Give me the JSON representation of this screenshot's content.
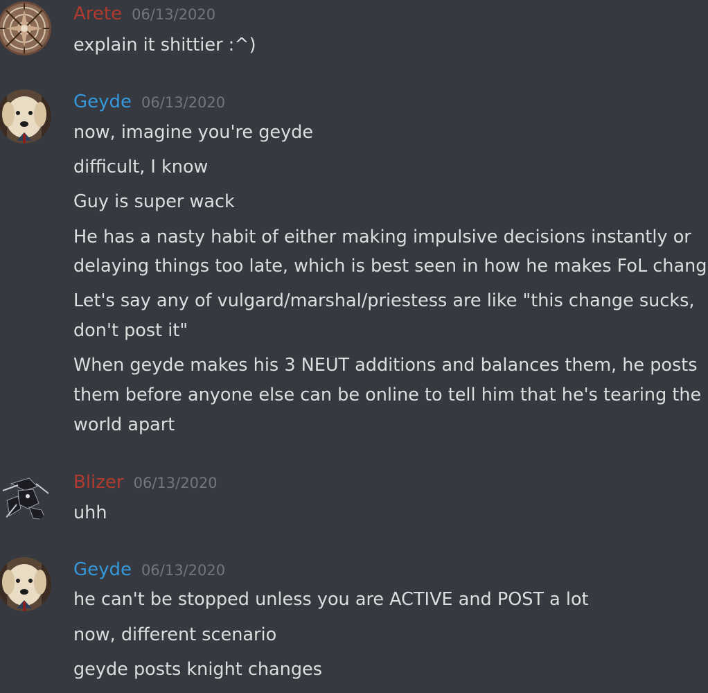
{
  "colors": {
    "background": "#36393f",
    "text": "#dcddde",
    "timestamp": "#72767d",
    "arete_name": "#b03a2e",
    "geyde_name": "#3498db",
    "blizer_name": "#b03a2e"
  },
  "groups": [
    {
      "username": "Arete",
      "timestamp": "06/13/2020",
      "avatar": "kaleidoscope-avatar",
      "messages": [
        "explain it shittier :^)"
      ]
    },
    {
      "username": "Geyde",
      "timestamp": "06/13/2020",
      "avatar": "dog-avatar",
      "messages": [
        "now, imagine you're geyde",
        "difficult, I know",
        "Guy is super wack",
        "He has a nasty habit of either making impulsive decisions instantly or",
        "delaying things too late, which is best seen in how he makes FoL changes",
        "Let's say any of vulgard/marshal/priestess are like \"this change sucks,",
        "don't post it\"",
        "When geyde makes his 3 NEUT additions and balances them, he posts",
        "them before anyone else can be online to tell him that he's tearing the",
        "world apart"
      ]
    },
    {
      "username": "Blizer",
      "timestamp": "06/13/2020",
      "avatar": "anime-figure-avatar",
      "messages": [
        "uhh"
      ]
    },
    {
      "username": "Geyde",
      "timestamp": "06/13/2020",
      "avatar": "dog-avatar",
      "messages": [
        "he can't be stopped unless you are ACTIVE and POST a lot",
        "now, different scenario",
        "geyde posts knight changes"
      ]
    }
  ]
}
